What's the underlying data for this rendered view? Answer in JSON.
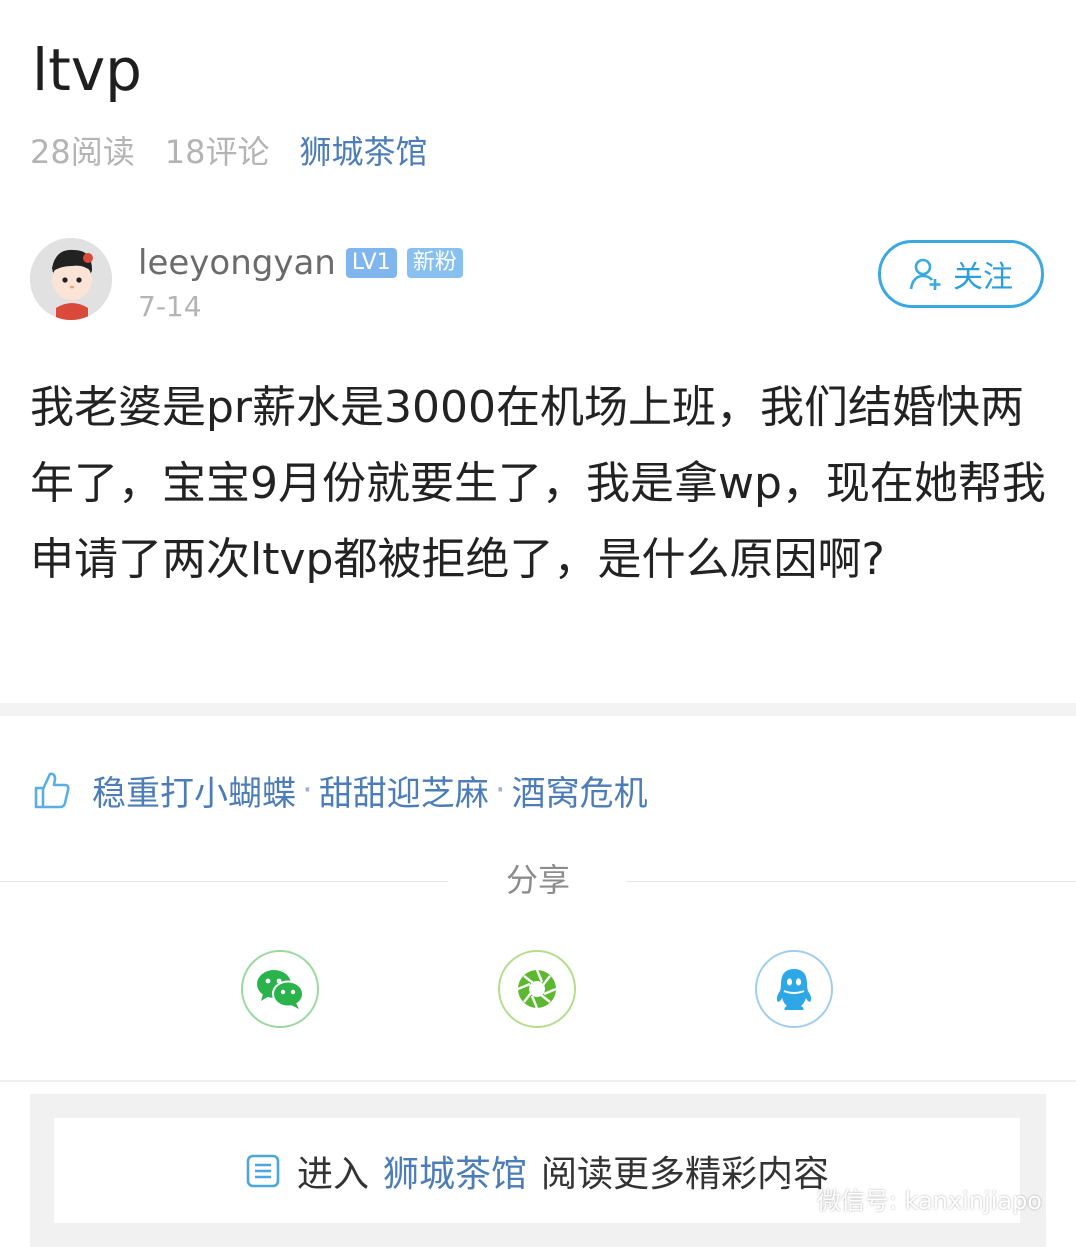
{
  "post": {
    "title": "ltvp",
    "stats": {
      "reads": "28阅读",
      "comments": "18评论",
      "forum": "狮城茶馆"
    },
    "author": {
      "name": "leeyongyan",
      "level_badge": "LV1",
      "fan_badge": "新粉",
      "date": "7-14",
      "follow_label": "关注"
    },
    "content": "我老婆是pr薪水是3000在机场上班，我们结婚快两年了，宝宝9月份就要生了，我是拿wp，现在她帮我申请了两次ltvp都被拒绝了，是什么原因啊?"
  },
  "likes": {
    "users": [
      "稳重打小蝴蝶",
      "甜甜迎芝麻",
      "酒窝危机"
    ],
    "separator": "·"
  },
  "share": {
    "label": "分享",
    "targets": [
      "wechat-icon",
      "moments-icon",
      "qq-icon"
    ]
  },
  "footer": {
    "enter_prefix": "进入",
    "forum_link": "狮城茶馆",
    "enter_suffix": "阅读更多精彩内容"
  },
  "watermark": {
    "text": "微信号: kanxinjiapo"
  },
  "colors": {
    "accent_blue": "#4d7db8",
    "follow_blue": "#39a9e0",
    "wechat_green": "#2ab34a",
    "qq_blue": "#2ea7e7"
  }
}
